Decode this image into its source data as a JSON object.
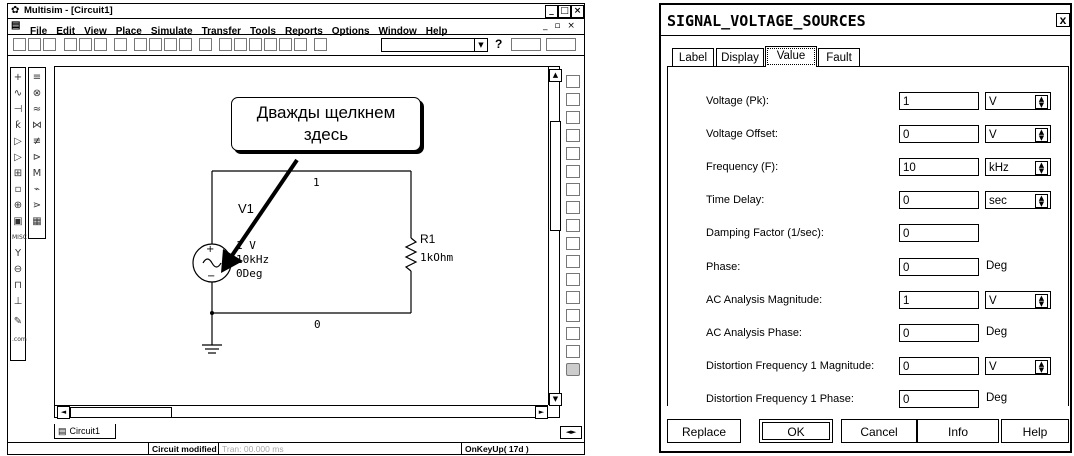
{
  "multisim": {
    "title": "Multisim - [Circuit1]",
    "menu": [
      "File",
      "Edit",
      "View",
      "Place",
      "Simulate",
      "Transfer",
      "Tools",
      "Reports",
      "Options",
      "Window",
      "Help"
    ],
    "help_button": "?",
    "callout_text": "Дважды щелкнем здесь",
    "schematic": {
      "node1": "1",
      "node0": "0",
      "v1_name": "V1",
      "v1_line1": "1 V",
      "v1_line2": "10kHz",
      "v1_line3": "0Deg",
      "r1_name": "R1",
      "r1_value": "1kOhm"
    },
    "tab_label": "Circuit1",
    "status": {
      "modified": "Circuit modified",
      "tran": "Tran: 00.000 ms",
      "key": "OnKeyUp( 17d )"
    }
  },
  "dialog": {
    "title": "SIGNAL_VOLTAGE_SOURCES",
    "close": "x",
    "tabs": [
      "Label",
      "Display",
      "Value",
      "Fault"
    ],
    "active_tab": "Value",
    "params": [
      {
        "label": "Voltage (Pk):",
        "value": "1",
        "unit": "V",
        "unit_kind": "select"
      },
      {
        "label": "Voltage Offset:",
        "value": "0",
        "unit": "V",
        "unit_kind": "select"
      },
      {
        "label": "Frequency (F):",
        "value": "10",
        "unit": "kHz",
        "unit_kind": "select"
      },
      {
        "label": "Time Delay:",
        "value": "0",
        "unit": "sec",
        "unit_kind": "select"
      },
      {
        "label": "Damping Factor (1/sec):",
        "value": "0",
        "unit": "",
        "unit_kind": "none"
      },
      {
        "label": "Phase:",
        "value": "0",
        "unit": "Deg",
        "unit_kind": "text"
      },
      {
        "label": "AC Analysis Magnitude:",
        "value": "1",
        "unit": "V",
        "unit_kind": "select"
      },
      {
        "label": "AC Analysis Phase:",
        "value": "0",
        "unit": "Deg",
        "unit_kind": "text"
      },
      {
        "label": "Distortion Frequency 1 Magnitude:",
        "value": "0",
        "unit": "V",
        "unit_kind": "select"
      },
      {
        "label": "Distortion Frequency 1 Phase:",
        "value": "0",
        "unit": "Deg",
        "unit_kind": "text"
      }
    ],
    "buttons": {
      "replace": "Replace",
      "ok": "OK",
      "cancel": "Cancel",
      "info": "Info",
      "help": "Help"
    }
  }
}
